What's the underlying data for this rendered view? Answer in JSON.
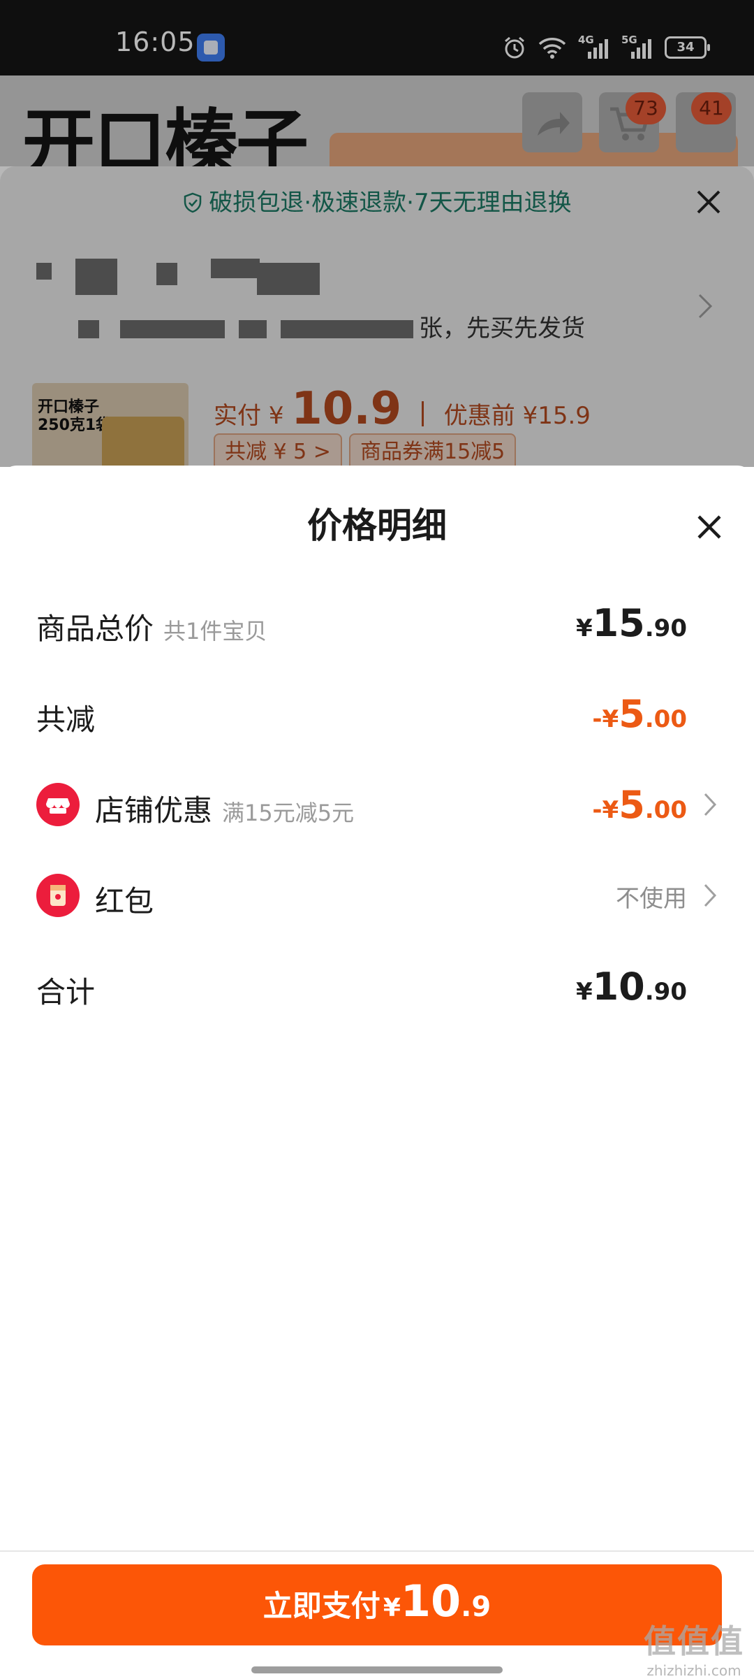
{
  "status_bar": {
    "time": "16:05",
    "battery": "34",
    "net1": "4G",
    "net2": "5G"
  },
  "background": {
    "title": "开口榛子",
    "badge_cart": "73",
    "badge_msg": "41",
    "guarantee": "破损包退·极速退款·7天无理由退换",
    "address_text": "张，先买先发货",
    "product_label_line1": "开口榛子",
    "product_label_line2": "250克1袋",
    "paid_label": "实付",
    "paid_currency": "¥",
    "paid_value": "10.9",
    "before_discount": "优惠前 ¥15.9",
    "chip_discount": "共减 ¥ 5 >",
    "chip_coupon": "商品券满15减5"
  },
  "sheet": {
    "title": "价格明细",
    "rows": {
      "total": {
        "label": "商品总价",
        "sub": "共1件宝贝",
        "cur": "¥",
        "big": "15",
        "small": ".90"
      },
      "discount": {
        "label": "共减",
        "cur": "-¥",
        "big": "5",
        "small": ".00"
      },
      "store": {
        "label": "店铺优惠",
        "sub": "满15元减5元",
        "cur": "-¥",
        "big": "5",
        "small": ".00"
      },
      "redpack": {
        "label": "红包",
        "value": "不使用"
      },
      "sum": {
        "label": "合计",
        "cur": "¥",
        "big": "10",
        "small": ".90"
      }
    }
  },
  "pay_button": {
    "label": "立即支付",
    "cur": "¥",
    "big": "10",
    "small": ".9"
  },
  "watermark": {
    "line1": "值值值",
    "line2": "zhizhizhi.com"
  },
  "colors": {
    "accent": "#fc5607",
    "discount_red": "#ec5a14",
    "guarantee_green": "#1b7863",
    "store_icon": "#ec1d3c"
  }
}
